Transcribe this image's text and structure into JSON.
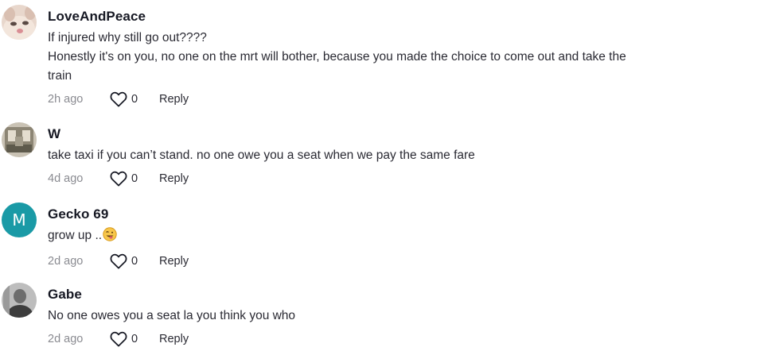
{
  "comments": [
    {
      "username": "LoveAndPeace",
      "lines": [
        "If injured why still go out????",
        "Honestly it's on you, no one on the mrt will bother, because you made the choice to come out and take the",
        "train"
      ],
      "time": "2h ago",
      "likes": "0",
      "reply_label": "Reply",
      "avatar_icon": "cat-photo-avatar"
    },
    {
      "username": "W",
      "lines": [
        "take taxi if you can’t stand. no one owe you a seat when we pay the same fare"
      ],
      "time": "4d ago",
      "likes": "0",
      "reply_label": "Reply",
      "avatar_icon": "room-photo-avatar"
    },
    {
      "username": "Gecko 69",
      "lines": [
        "grow up .."
      ],
      "emoji": "grinning-tongue-emoji",
      "time": "2d ago",
      "likes": "0",
      "reply_label": "Reply",
      "avatar_letter": "M",
      "avatar_color": "#1a9aa6"
    },
    {
      "username": "Gabe",
      "lines": [
        "No one owes you a seat la you think you who"
      ],
      "time": "2d ago",
      "likes": "0",
      "reply_label": "Reply",
      "avatar_icon": "person-photo-avatar"
    }
  ],
  "icons": {
    "like": "heart-outline-icon"
  },
  "colors": {
    "text": "#161823",
    "muted": "#8a8b91",
    "avatar_teal": "#1a9aa6"
  }
}
